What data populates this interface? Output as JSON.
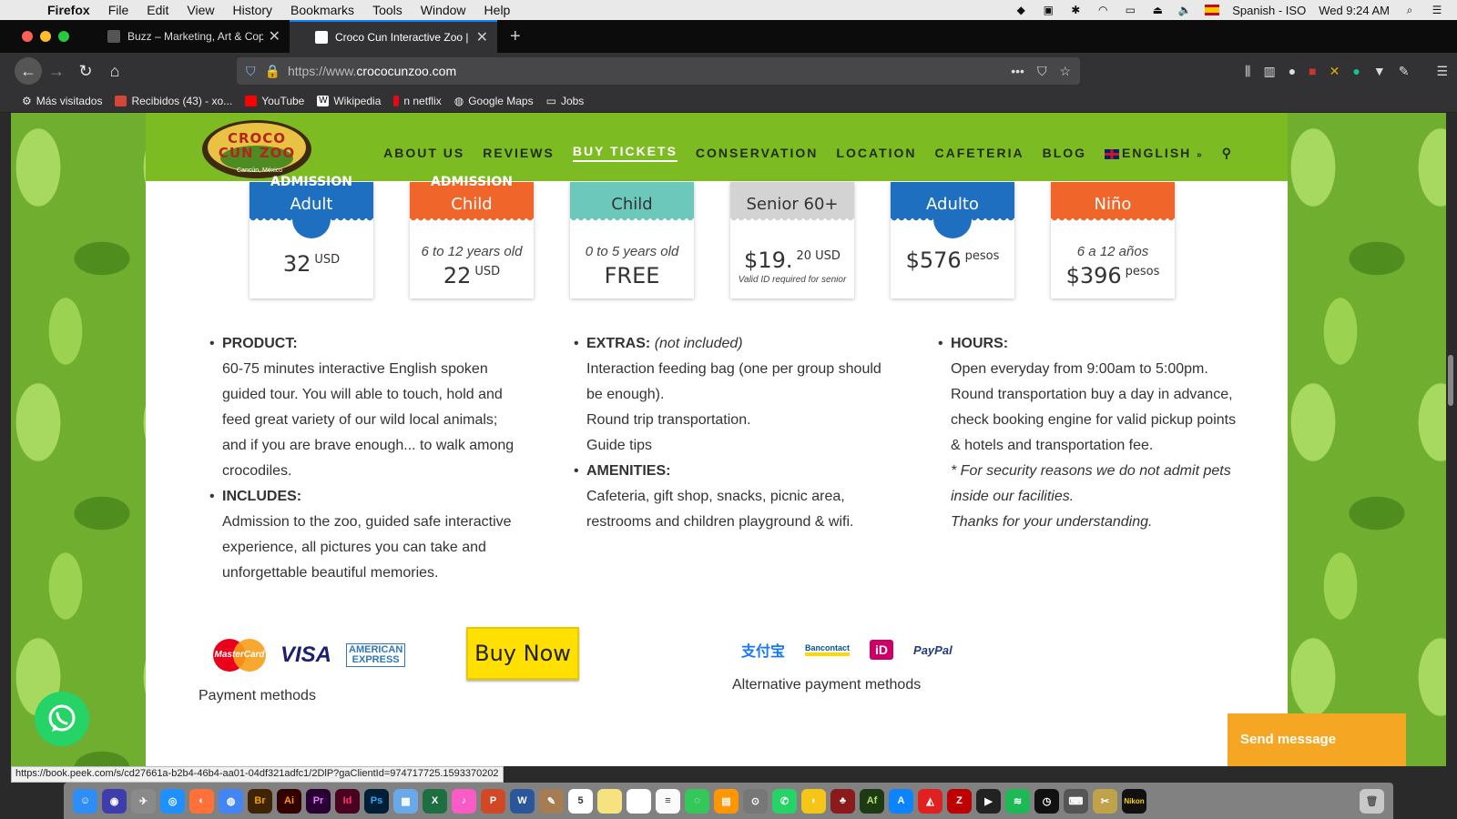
{
  "menubar": {
    "app_name": "Firefox",
    "items": [
      "File",
      "Edit",
      "View",
      "History",
      "Bookmarks",
      "Tools",
      "Window",
      "Help"
    ],
    "input_source": "Spanish - ISO",
    "clock": "Wed 9:24 AM"
  },
  "tabs": [
    {
      "title": "Buzz – Marketing, Art & Copy",
      "active": false
    },
    {
      "title": "Croco Cun Interactive Zoo | Live",
      "active": true
    }
  ],
  "navbar": {
    "url_prefix": "https://www.",
    "url_domain": "crococunzoo.com"
  },
  "bookmarks": [
    {
      "label": "Más visitados",
      "icon": "gear-icon"
    },
    {
      "label": "Recibidos (43) - xo...",
      "icon": "gmail-icon"
    },
    {
      "label": "YouTube",
      "icon": "youtube-icon"
    },
    {
      "label": "Wikipedia",
      "icon": "wikipedia-icon"
    },
    {
      "label": "n netflix",
      "icon": "netflix-icon"
    },
    {
      "label": "Google Maps",
      "icon": "globe-icon"
    },
    {
      "label": "Jobs",
      "icon": "folder-icon"
    }
  ],
  "site": {
    "logo_text": "CROCO CUN ZOO",
    "logo_sub": "Cancún, México",
    "nav": [
      {
        "label": "ABOUT US",
        "active": false
      },
      {
        "label": "REVIEWS",
        "active": false
      },
      {
        "label": "BUY TICKETS",
        "active": true
      },
      {
        "label": "CONSERVATION",
        "active": false
      },
      {
        "label": "LOCATION",
        "active": false
      },
      {
        "label": "CAFETERIA",
        "active": false
      },
      {
        "label": "BLOG",
        "active": false
      }
    ],
    "language": "ENGLISH"
  },
  "cards": [
    {
      "top": "ADMISSION",
      "title": "Adult",
      "subtitle": "",
      "price": "32",
      "unit": "USD",
      "note": "",
      "color": "#1f6fc0"
    },
    {
      "top": "ADMISSION",
      "title": "Child",
      "subtitle": "6 to 12 years old",
      "price": "22",
      "unit": "USD",
      "note": "",
      "color": "#f0652a"
    },
    {
      "top": "",
      "title": "Child",
      "subtitle": "0 to 5 years old",
      "price": "FREE",
      "unit": "",
      "note": "",
      "color": "#6dc8bc"
    },
    {
      "top": "",
      "title": "Senior 60+",
      "subtitle": "",
      "price": "$19.",
      "unit": "20 USD",
      "note": "Valid ID required for senior",
      "color": "#d3d3d3"
    },
    {
      "top": "",
      "title": "Adulto",
      "subtitle": "",
      "price": "$576",
      "unit": "pesos",
      "note": "",
      "color": "#1f6fc0"
    },
    {
      "top": "",
      "title": "Niño",
      "subtitle": "6 a 12 años",
      "price": "$396",
      "unit": "pesos",
      "note": "",
      "color": "#f0652a"
    }
  ],
  "info": {
    "product": {
      "label": "PRODUCT:",
      "lines": [
        "60-75 minutes interactive English spoken",
        "guided tour. You will able to touch, hold and",
        "feed great variety of our wild local animals;",
        "and if you are brave enough... to walk among",
        "crocodiles."
      ]
    },
    "includes": {
      "label": "INCLUDES:",
      "lines": [
        "Admission to the zoo, guided safe interactive",
        "experience, all pictures you can take and",
        "unforgettable beautiful memories."
      ]
    },
    "extras": {
      "label": "EXTRAS:",
      "note": "(not included)",
      "lines": [
        "Interaction feeding bag (one per group should",
        "be enough).",
        "Round trip transportation.",
        "Guide tips"
      ]
    },
    "amenities": {
      "label": "AMENITIES:",
      "lines": [
        "Cafeteria, gift shop, snacks, picnic area,",
        "restrooms and children playground & wifi."
      ]
    },
    "hours": {
      "label": "HOURS:",
      "lines": [
        "Open everyday from 9:00am to 5:00pm.",
        "Round transportation buy a day in advance,",
        "check booking engine for valid pickup points",
        "& hotels and transportation fee."
      ],
      "italic_lines": [
        "* For security reasons we do not admit pets",
        "inside our facilities.",
        "Thanks for your understanding."
      ]
    }
  },
  "payment": {
    "mastercard": "MasterCard",
    "visa": "VISA",
    "amex_top": "AMERICAN",
    "amex_bottom": "EXPRESS",
    "caption": "Payment methods",
    "buy_now": "Buy Now",
    "alt": [
      "支付宝",
      "Bancontact",
      "iD",
      "PayPal"
    ],
    "alt_caption": "Alternative payment methods"
  },
  "send_message": "Send message",
  "status_url": "https://book.peek.com/s/cd27661a-b2b4-46b4-aa01-04df321adfc1/2DlP?gaClientId=974717725.1593370202",
  "dock": [
    "Finder",
    "Siri",
    "Launchpad",
    "Safari",
    "Firefox",
    "Chrome",
    "Br",
    "Ai",
    "Pr",
    "Id",
    "Ps",
    "Preview",
    "Excel",
    "iTunes",
    "PowerPoint",
    "Word",
    "Notes",
    "Calendar",
    "Stickies",
    "Photos",
    "Reminders",
    "Messages",
    "Books",
    "Disk",
    "WhatsApp",
    "Cyberduck",
    "Keychain",
    "Illustrator",
    "App Store",
    "Acrobat",
    "Filezilla",
    "Terminal",
    "Spotify",
    "Clock",
    "Keyboard",
    "Tools",
    "Nikon",
    "Trash"
  ]
}
